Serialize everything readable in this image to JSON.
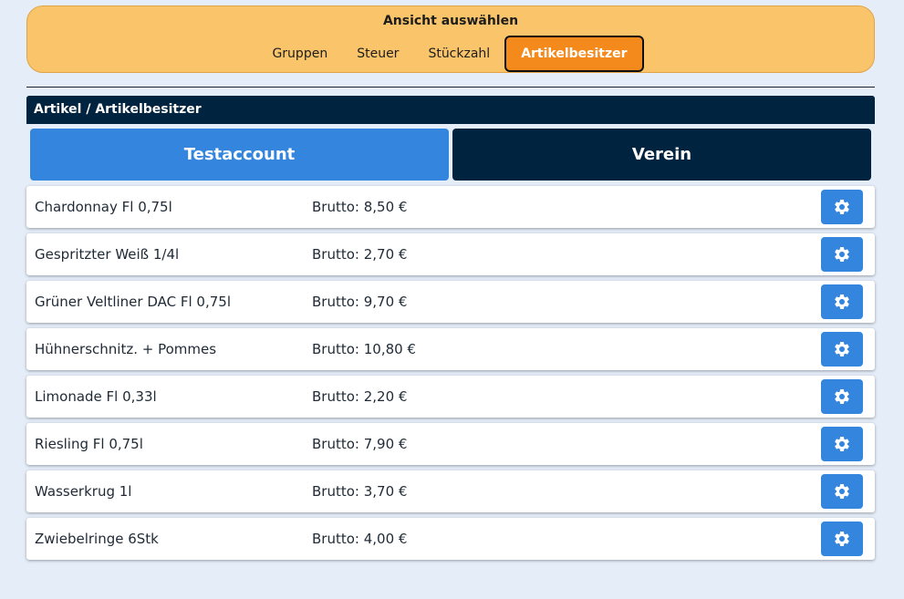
{
  "view_selector": {
    "title": "Ansicht auswählen",
    "tabs": [
      {
        "label": "Gruppen",
        "active": false
      },
      {
        "label": "Steuer",
        "active": false
      },
      {
        "label": "Stückzahl",
        "active": false
      },
      {
        "label": "Artikelbesitzer",
        "active": true
      }
    ]
  },
  "section": {
    "title": "Artikel / Artikelbesitzer"
  },
  "owners": [
    {
      "label": "Testaccount",
      "selected": true
    },
    {
      "label": "Verein",
      "selected": false
    }
  ],
  "articles": [
    {
      "name": "Chardonnay Fl 0,75l",
      "price": "Brutto: 8,50 €"
    },
    {
      "name": "Gespritzter Weiß 1/4l",
      "price": "Brutto: 2,70 €"
    },
    {
      "name": "Grüner Veltliner DAC Fl 0,75l",
      "price": "Brutto: 9,70 €"
    },
    {
      "name": "Hühnerschnitz. + Pommes",
      "price": "Brutto: 10,80 €"
    },
    {
      "name": "Limonade Fl 0,33l",
      "price": "Brutto: 2,20 €"
    },
    {
      "name": "Riesling Fl 0,75l",
      "price": "Brutto: 7,90 €"
    },
    {
      "name": "Wasserkrug 1l",
      "price": "Brutto: 3,70 €"
    },
    {
      "name": "Zwiebelringe 6Stk",
      "price": "Brutto: 4,00 €"
    }
  ],
  "icons": {
    "row_action": "gear-icon"
  },
  "colors": {
    "background": "#e5edf9",
    "view_panel": "#f9c46a",
    "active_tab": "#f48a1c",
    "header_dark": "#00233f",
    "primary_blue": "#3385de"
  }
}
